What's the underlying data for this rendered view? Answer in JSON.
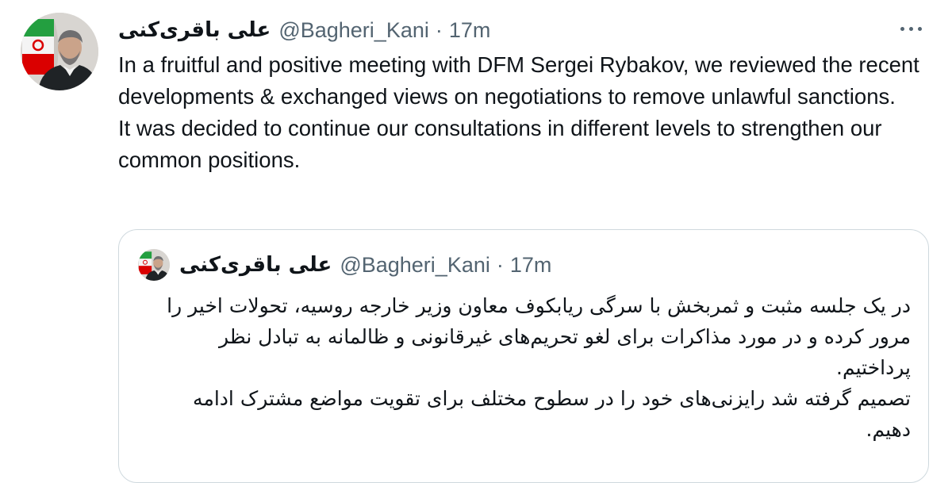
{
  "tweet": {
    "author": {
      "display_name": "علی باقری‌کنی",
      "handle": "@Bagheri_Kani",
      "separator": "·",
      "time": "17m"
    },
    "paragraphs": [
      "In a fruitful and positive meeting with DFM Sergei Rybakov, we reviewed the recent developments & exchanged views on negotiations to remove unlawful sanctions.",
      "It was decided to continue our consultations in different levels to strengthen our common positions."
    ],
    "more_icon": "more-horizontal-icon"
  },
  "quoted_tweet": {
    "author": {
      "display_name": "علی باقری‌کنی",
      "handle": "@Bagheri_Kani",
      "separator": "·",
      "time": "17m"
    },
    "paragraphs": [
      "در یک جلسه مثبت و ثمربخش با سرگی ریابکوف معاون وزیر خارجه روسیه، تحولات اخیر را مرور کرده و در مورد مذاکرات برای لغو تحریم‌های غیرقانونی و ظالمانه به تبادل نظر پرداختیم.",
      "تصمیم گرفته شد رایزنی‌های خود را در سطوح مختلف برای تقویت مواضع مشترک ادامه دهیم."
    ]
  },
  "colors": {
    "text_primary": "#0f1419",
    "text_secondary": "#536471",
    "border": "#cfd9de",
    "flag_green": "#239f40",
    "flag_red": "#da0000"
  }
}
